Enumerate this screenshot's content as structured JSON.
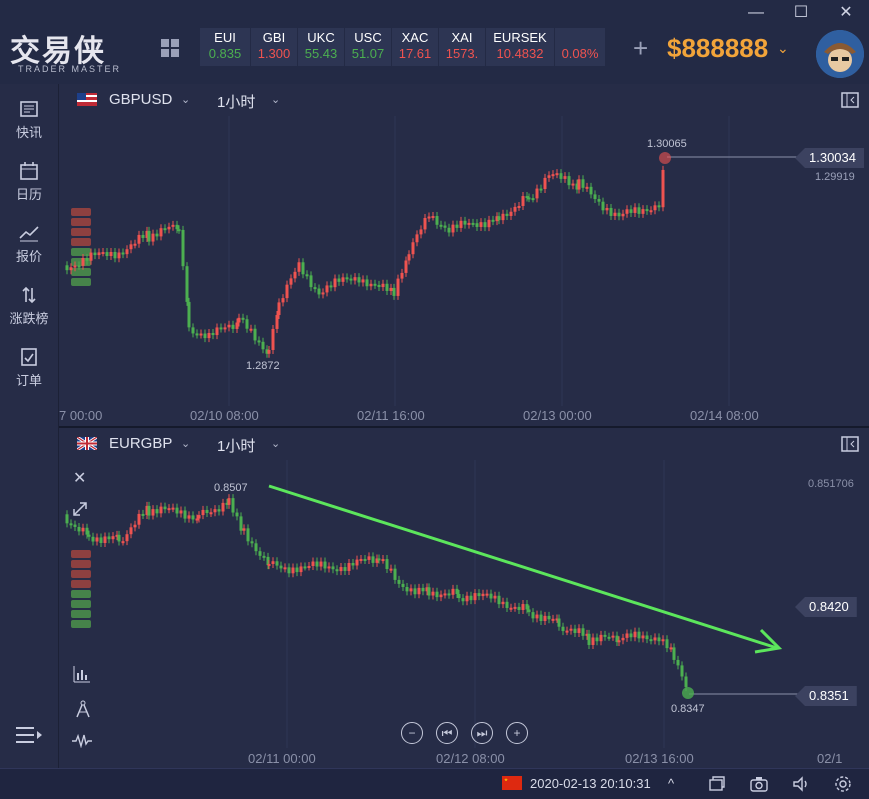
{
  "app": {
    "logo_text": "交易侠",
    "logo_subtext": "TRADER MASTER",
    "balance": "$888888",
    "window_controls": [
      "minimize-icon",
      "maximize-icon",
      "close-icon"
    ]
  },
  "tickers": [
    {
      "name": "EUI",
      "value": "0.835",
      "direction": "down"
    },
    {
      "name": "GBI",
      "value": "1.300",
      "direction": "up"
    },
    {
      "name": "UKC",
      "value": "55.43",
      "direction": "down"
    },
    {
      "name": "USC",
      "value": "51.07",
      "direction": "down"
    },
    {
      "name": "XAC",
      "value": "17.61",
      "direction": "up"
    },
    {
      "name": "XAI",
      "value": "1573.",
      "direction": "up"
    },
    {
      "name": "EURSEK",
      "value": "10.4832",
      "direction": "up"
    },
    {
      "name": "",
      "value": "0.08%",
      "direction": "up"
    }
  ],
  "sidebar": {
    "items": [
      {
        "label": "快讯",
        "icon": "news-icon"
      },
      {
        "label": "日历",
        "icon": "calendar-icon"
      },
      {
        "label": "报价",
        "icon": "quote-chart-icon"
      },
      {
        "label": "涨跌榜",
        "icon": "updown-arrows-icon"
      },
      {
        "label": "订单",
        "icon": "order-icon"
      }
    ],
    "bottom_icon": "menu-expand-icon"
  },
  "panels": [
    {
      "symbol": "GBPUSD",
      "timeframe": "1小时",
      "x_labels": [
        "7 00:00",
        "02/10 08:00",
        "02/11 16:00",
        "02/13 00:00",
        "02/14 08:00"
      ],
      "high_label": "1.30065",
      "low_label": "1.2872",
      "current_price": "1.30034",
      "secondary_price": "1.29919"
    },
    {
      "symbol": "EURGBP",
      "timeframe": "1小时",
      "x_labels": [
        "02/11 00:00",
        "02/12 08:00",
        "02/13 16:00",
        "02/1"
      ],
      "high_label": "0.8507",
      "low_label": "0.8347",
      "current_price": "0.8351",
      "level_price": "0.8420",
      "top_price": "0.851706",
      "tools": [
        "close-icon",
        "expand-icon",
        "indicator-icon",
        "drawing-compass-icon",
        "wave-icon"
      ],
      "nav": [
        "zoom-out-icon",
        "skip-back-icon",
        "skip-forward-icon",
        "zoom-in-icon"
      ]
    }
  ],
  "status": {
    "datetime": "2020-02-13 20:10:31",
    "caret": "^",
    "icons": [
      "windows-icon",
      "camera-icon",
      "sound-icon",
      "settings-icon"
    ]
  },
  "colors": {
    "up": "#ef5350",
    "down": "#4caf50",
    "background": "#262c47",
    "accent": "#f2a43a",
    "trend_arrow": "#5ce65c"
  }
}
